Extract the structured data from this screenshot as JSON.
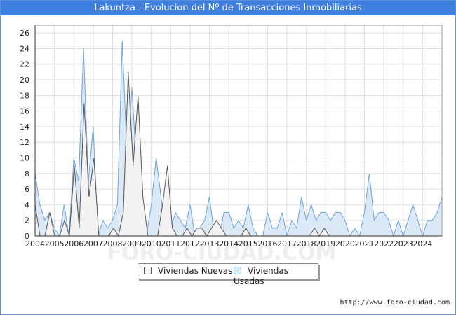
{
  "header": {
    "title": "Lakuntza - Evolucion del Nº de Transacciones Inmobiliarias"
  },
  "footer": {
    "source": "http://www.foro-ciudad.com"
  },
  "watermark": "FORO-CIUDAD.COM",
  "chart_data": {
    "type": "area",
    "x_axis": {
      "labels": [
        "2004",
        "2005",
        "2006",
        "2007",
        "2008",
        "2009",
        "2010",
        "2011",
        "2012",
        "2013",
        "2014",
        "2015",
        "2016",
        "2017",
        "2018",
        "2019",
        "2020",
        "2021",
        "2022",
        "2023",
        "2024"
      ],
      "range": [
        "2004-Q1",
        "2024-Q4"
      ]
    },
    "y_axis": {
      "ticks": [
        0,
        2,
        4,
        6,
        8,
        10,
        12,
        14,
        16,
        18,
        20,
        22,
        24,
        26
      ],
      "ylim": [
        0,
        27
      ]
    },
    "grid": true,
    "legend_position": "bottom-center",
    "series": [
      {
        "name": "Viviendas Nuevas",
        "color": "#555555",
        "fill": "#f2f2f2",
        "values": [
          4,
          0,
          0,
          3,
          0,
          0,
          2,
          0,
          9,
          1,
          17,
          5,
          10,
          0,
          0,
          0,
          1,
          0,
          3,
          21,
          9,
          18,
          5,
          0,
          0,
          0,
          4,
          9,
          1,
          0,
          0,
          1,
          0,
          1,
          1,
          0,
          1,
          2,
          1,
          0,
          0,
          0,
          0,
          1,
          0,
          0,
          0,
          0,
          0,
          0,
          0,
          0,
          0,
          0,
          0,
          0,
          0,
          1,
          0,
          1,
          0,
          0,
          0,
          0,
          0,
          0,
          0,
          0,
          0,
          0,
          0,
          0,
          0,
          0,
          0,
          0,
          0,
          0,
          0,
          0,
          0,
          0,
          0,
          0
        ]
      },
      {
        "name": "Viviendas Usadas",
        "color": "#6fa3dc",
        "fill": "#dbe8f6",
        "values": [
          8,
          4,
          2,
          3,
          1,
          0,
          4,
          0,
          10,
          7,
          24,
          7,
          14,
          0,
          2,
          1,
          2,
          4,
          25,
          10,
          19,
          8,
          0,
          0,
          4,
          10,
          5,
          0,
          1,
          3,
          2,
          1,
          4,
          0,
          1,
          2,
          5,
          0,
          0,
          3,
          3,
          1,
          2,
          1,
          4,
          1,
          0,
          0,
          3,
          1,
          1,
          3,
          0,
          2,
          1,
          5,
          2,
          4,
          2,
          3,
          3,
          2,
          3,
          3,
          2,
          0,
          1,
          0,
          3,
          8,
          2,
          3,
          3,
          2,
          0,
          2,
          0,
          2,
          4,
          2,
          0,
          2,
          2,
          3,
          5
        ]
      }
    ]
  }
}
